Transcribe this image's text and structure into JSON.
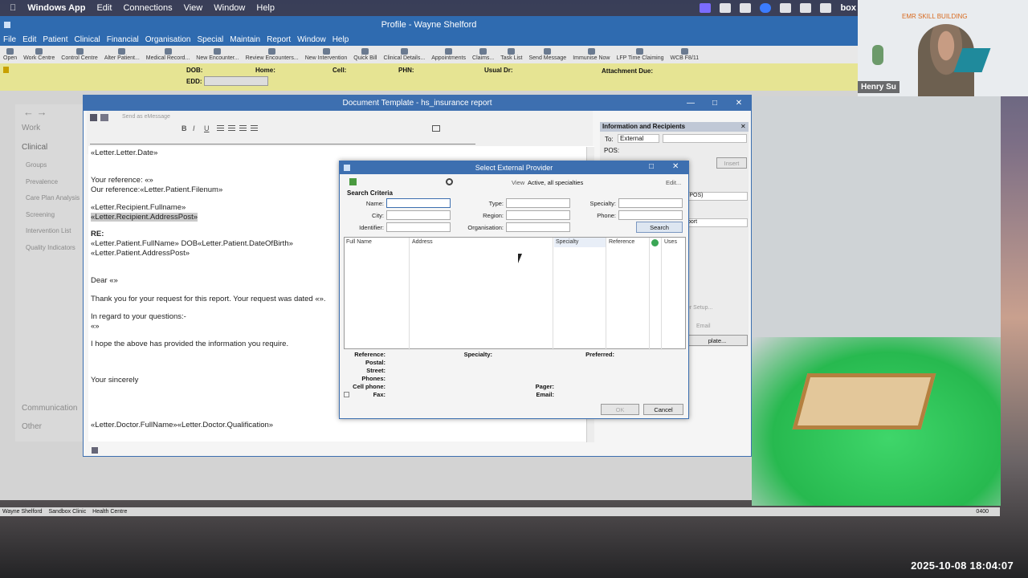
{
  "macbar": {
    "app_name": "Windows App",
    "menu": [
      "Edit",
      "Connections",
      "View",
      "Window",
      "Help"
    ],
    "tray_box": "box"
  },
  "emr": {
    "title": "Profile - Wayne Shelford",
    "menu": [
      "File",
      "Edit",
      "Patient",
      "Clinical",
      "Financial",
      "Organisation",
      "Special",
      "Maintain",
      "Report",
      "Window",
      "Help"
    ],
    "toolbar": [
      "Open",
      "Work Centre",
      "Control Centre",
      "Alter Patient...",
      "Medical Record...",
      "New Encounter...",
      "Review Encounters...",
      "New Intervention",
      "Quick Bill",
      "Clinical Details...",
      "Appointments",
      "Claims...",
      "Task List",
      "Send Message",
      "Immunise Now",
      "LFP Time Claiming",
      "WCB F8/11"
    ],
    "patient": {
      "dob_label": "DOB:",
      "edd_label": "EDD:",
      "home_label": "Home:",
      "cell_label": "Cell:",
      "phn_label": "PHN:",
      "usual_dr_label": "Usual Dr:",
      "attachment_label": "Attachment Due:"
    },
    "sidenav": {
      "work": "Work",
      "clinical": "Clinical",
      "items": [
        "Groups",
        "Prevalence",
        "Care Plan Analysis",
        "Screening",
        "Intervention List",
        "Quality Indicators"
      ],
      "communication": "Communication",
      "other": "Other"
    }
  },
  "doc": {
    "title": "Document Template - hs_insurance report",
    "send_label": "Send as eMessage",
    "lines": [
      "«Letter.Letter.Date»",
      "Your reference:             «»",
      "Our reference:«Letter.Patient.Filenum»",
      "«Letter.Recipient.Fullname»",
      "«Letter.Recipient.AddressPost»",
      "RE:",
      "«Letter.Patient.FullName»  DOB«Letter.Patient.DateOfBirth»",
      "«Letter.Patient.AddressPost»",
      "Dear «»",
      "Thank you for your request for this report. Your request was dated «».",
      "In regard to your questions:-",
      "«»",
      "I hope the above has provided the information you require.",
      "Your sincerely",
      "«Letter.Doctor.FullName»«Letter.Doctor.Qualification»"
    ],
    "info": {
      "title": "Information and Recipients",
      "to_label": "To:",
      "to_value": "External",
      "pos_label": "POS:",
      "insert": "Insert",
      "pos_short": "(POS)",
      "report": "port",
      "setup": "er Setup...",
      "email": "Email",
      "template": "plate..."
    }
  },
  "dialog": {
    "title": "Select External Provider",
    "view_label": "View",
    "view_value": "Active, all specialties",
    "edit": "Edit...",
    "search_criteria": "Search Criteria",
    "name_label": "Name:",
    "type_label": "Type:",
    "specialty_label": "Specialty:",
    "city_label": "City:",
    "region_label": "Region:",
    "phone_label": "Phone:",
    "identifier_label": "Identifier:",
    "organisation_label": "Organisation:",
    "search_button": "Search",
    "columns": [
      "Full Name",
      "Address",
      "Specialty",
      "Reference",
      "Uses"
    ],
    "details": {
      "reference": "Reference:",
      "specialty": "Specialty:",
      "preferred": "Preferred:",
      "postal": "Postal:",
      "street": "Street:",
      "phones": "Phones:",
      "cell": "Cell phone:",
      "pager": "Pager:",
      "fax": "Fax:",
      "email": "Email:"
    },
    "ok": "OK",
    "cancel": "Cancel"
  },
  "webcam": {
    "name": "Henry Su",
    "banner": "EMR SKILL BUILDING"
  },
  "status": {
    "user": "Wayne Shelford",
    "clinic": "Sandbox Clinic",
    "centre": "Health Centre",
    "code": "0400"
  },
  "timestamp": "2025-10-08  18:04:07"
}
